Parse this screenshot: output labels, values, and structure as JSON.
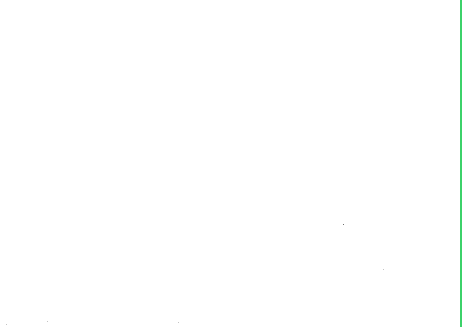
{
  "colors": {
    "background": "#ffffff",
    "edge_line": "#3cd26a",
    "speck": "#9a9a9a"
  }
}
